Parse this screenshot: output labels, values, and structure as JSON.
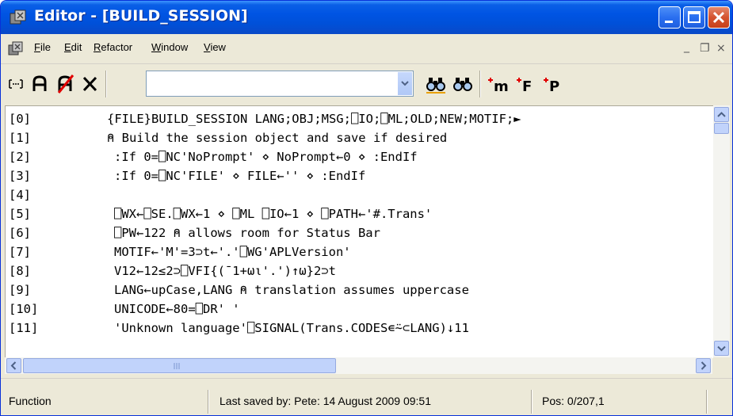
{
  "window": {
    "title": "Editor - [BUILD_SESSION]"
  },
  "menu": {
    "items": [
      {
        "label": "File",
        "underline": "F",
        "rest": "ile"
      },
      {
        "label": "Edit",
        "underline": "E",
        "rest": "dit"
      },
      {
        "label": "Refactor",
        "underline": "R",
        "rest": "efactor"
      },
      {
        "label": "Window",
        "underline": "W",
        "rest": "indow"
      },
      {
        "label": "View",
        "underline": "V",
        "rest": "iew"
      }
    ],
    "mdi_minimize": "_",
    "mdi_restore": "❐",
    "mdi_close": "×"
  },
  "toolbar": {
    "search_value": "",
    "icons": [
      "select-lines-icon",
      "toggle-a-icon",
      "clear-a-icon",
      "delete-x-icon",
      "find-icon",
      "find-next-icon",
      "add-method-icon",
      "add-function-icon",
      "add-property-icon"
    ]
  },
  "code": {
    "lines": [
      {
        "num": "[0]",
        "text": "{FILE}BUILD_SESSION LANG;OBJ;MSG;⎕IO;⎕ML;OLD;NEW;MOTIF;►"
      },
      {
        "num": "[1]",
        "text": "⍝ Build the session object and save if desired"
      },
      {
        "num": "[2]",
        "text": ":If 0=⎕NC'NoPrompt' ⋄ NoPrompt←0 ⋄ :EndIf"
      },
      {
        "num": "[3]",
        "text": ":If 0=⎕NC'FILE' ⋄ FILE←'' ⋄ :EndIf"
      },
      {
        "num": "[4]",
        "text": ""
      },
      {
        "num": "[5]",
        "text": "⎕WX←⎕SE.⎕WX←1 ⋄ ⎕ML ⎕IO←1 ⋄ ⎕PATH←'#.Trans'"
      },
      {
        "num": "[6]",
        "text": "⎕PW←122 ⍝ allows room for Status Bar"
      },
      {
        "num": "[7]",
        "text": "MOTIF←'M'=3⊃t←'.'⎕WG'APLVersion'"
      },
      {
        "num": "[8]",
        "text": "V12←12≤2⊃⎕VFI{(¯1+ω⍳'.')↑ω}2⊃t"
      },
      {
        "num": "[9]",
        "text": "LANG←upCase,LANG ⍝ translation assumes uppercase"
      },
      {
        "num": "[10]",
        "text": "UNICODE←80=⎕DR' '"
      },
      {
        "num": "[11]",
        "text": "'Unknown language'⎕SIGNAL(Trans.CODES∊⍨⊂LANG)↓11"
      }
    ]
  },
  "status": {
    "type": "Function",
    "saved": "Last saved by: Pete: 14 August 2009 09:51",
    "pos": "Pos: 0/207,1"
  },
  "colors": {
    "titlebar": "#0054e3",
    "close_button": "#d5532f",
    "chrome": "#ece9d8",
    "scroll_button": "#c1d3fb"
  }
}
